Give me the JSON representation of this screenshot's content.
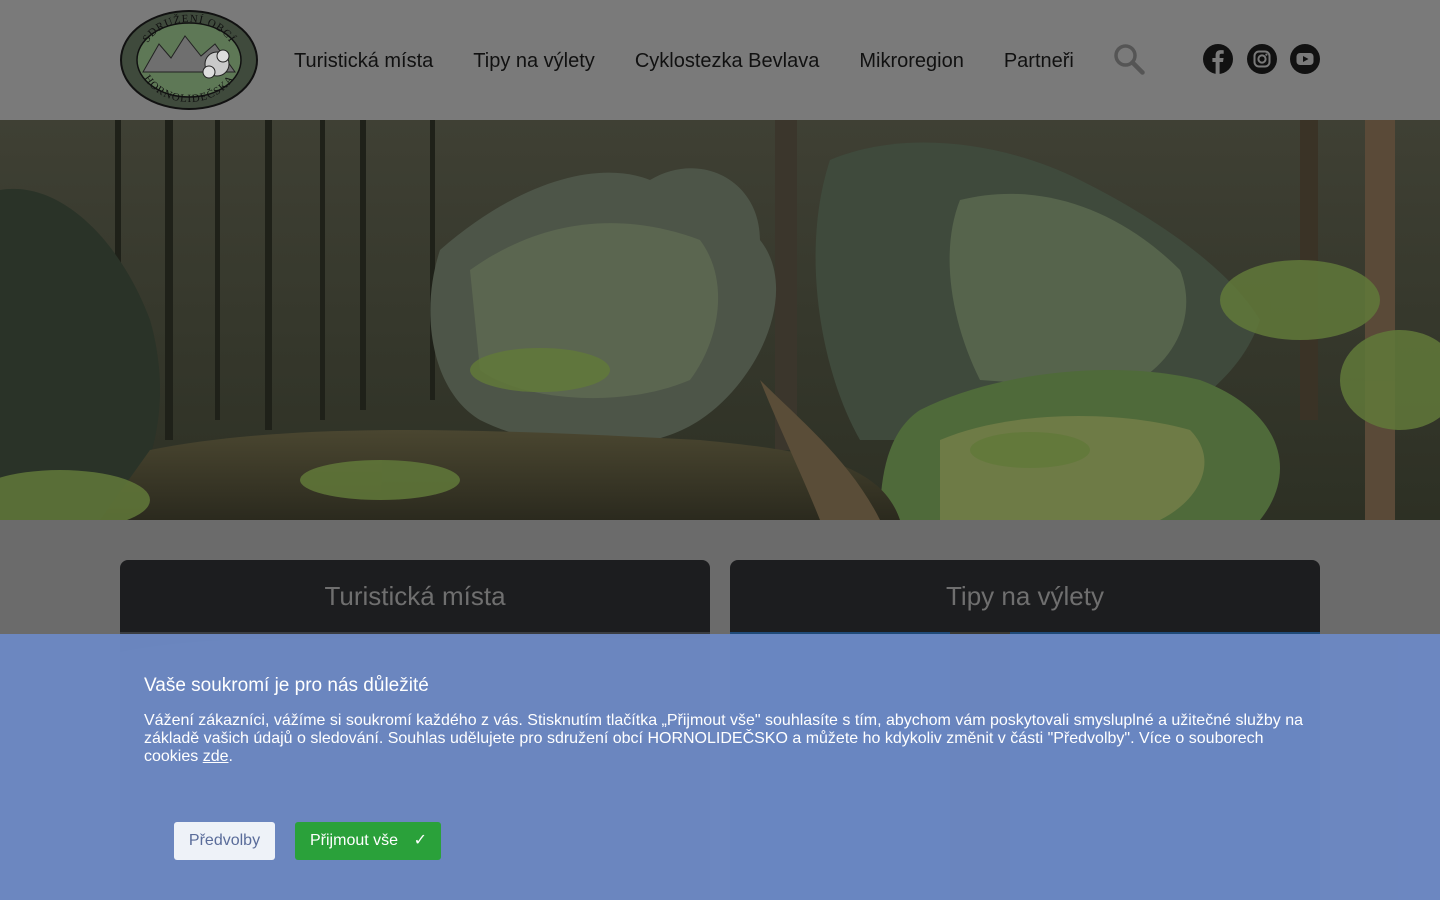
{
  "header": {
    "logo": {
      "top_text": "SDRUŽENÍ OBCÍ",
      "bottom_text": "HORNOLIDEČSKA"
    },
    "nav": [
      "Turistická místa",
      "Tipy na výlety",
      "Cyklostezka Bevlava",
      "Mikroregion",
      "Partneři"
    ],
    "icons": {
      "search": "search-icon",
      "facebook": "facebook-icon",
      "instagram": "instagram-icon",
      "youtube": "youtube-icon"
    }
  },
  "cards": [
    {
      "title": "Turistická místa"
    },
    {
      "title": "Tipy na výlety"
    }
  ],
  "cookie": {
    "title": "Vaše soukromí je pro nás důležité",
    "text_before": "Vážení zákazníci, vážíme si soukromí každého z vás. Stisknutím tlačítka „Přijmout vše\" souhlasíte s tím, abychom vám poskytovali smysluplné a užitečné služby na základě vašich údajů o sledování. Souhlas udělujete pro sdružení obcí HORNOLIDEČSKO a můžete ho kdykoliv změnit v části \"Předvolby\". Více o souborech cookies ",
    "link_text": "zde",
    "text_after": ".",
    "pref_label": "Předvolby",
    "accept_label": "Přijmout vše",
    "accept_icon": "✓"
  },
  "colors": {
    "accent_green": "#2aa13a",
    "banner_blue": "#6c88c4"
  }
}
